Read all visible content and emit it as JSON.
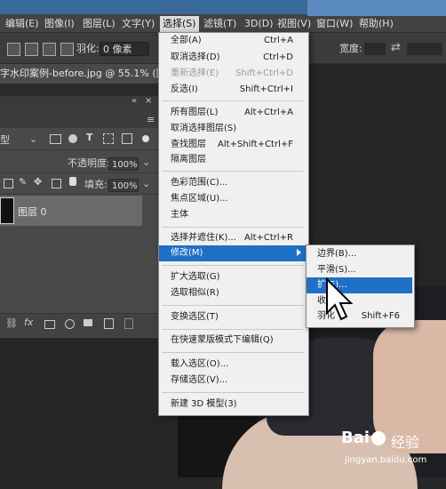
{
  "menubar": {
    "items": [
      "编辑(E)",
      "图像(I)",
      "图层(L)",
      "文字(Y)",
      "选择(S)",
      "滤镜(T)",
      "3D(D)",
      "视图(V)",
      "窗口(W)",
      "帮助(H)"
    ]
  },
  "options_bar": {
    "feather_label": "羽化:",
    "feather_value": "0 像素",
    "width_label": "宽度:"
  },
  "document": {
    "tab_title": "字水印案例-before.jpg @ 55.1% (图层 0"
  },
  "layers_panel": {
    "kind_filter": "型",
    "opacity_label": "不透明度:",
    "opacity_value": "100%",
    "lock_label": "锁定:",
    "fill_label": "填充:",
    "fill_value": "100%",
    "layer_name": "图层 0",
    "footer_icons": [
      "link-icon",
      "fx-icon",
      "mask-icon",
      "adjustment-icon",
      "folder-icon",
      "new-layer-icon",
      "trash-icon"
    ]
  },
  "select_menu": {
    "items": [
      {
        "label": "全部(A)",
        "shortcut": "Ctrl+A",
        "disabled": false
      },
      {
        "label": "取消选择(D)",
        "shortcut": "Ctrl+D",
        "disabled": false
      },
      {
        "label": "重新选择(E)",
        "shortcut": "Shift+Ctrl+D",
        "disabled": true
      },
      {
        "label": "反选(I)",
        "shortcut": "Shift+Ctrl+I",
        "disabled": false
      },
      {
        "label": "所有图层(L)",
        "shortcut": "Alt+Ctrl+A",
        "disabled": false
      },
      {
        "label": "取消选择图层(S)",
        "shortcut": "",
        "disabled": false
      },
      {
        "label": "查找图层",
        "shortcut": "Alt+Shift+Ctrl+F",
        "disabled": false
      },
      {
        "label": "隔离图层",
        "shortcut": "",
        "disabled": false
      },
      {
        "label": "色彩范围(C)...",
        "shortcut": "",
        "disabled": false
      },
      {
        "label": "焦点区域(U)...",
        "shortcut": "",
        "disabled": false
      },
      {
        "label": "主体",
        "shortcut": "",
        "disabled": false
      },
      {
        "label": "选择并遮住(K)...",
        "shortcut": "Alt+Ctrl+R",
        "disabled": false
      },
      {
        "label": "修改(M)",
        "shortcut": "",
        "disabled": false
      },
      {
        "label": "扩大选取(G)",
        "shortcut": "",
        "disabled": false
      },
      {
        "label": "选取相似(R)",
        "shortcut": "",
        "disabled": false
      },
      {
        "label": "变换选区(T)",
        "shortcut": "",
        "disabled": false
      },
      {
        "label": "在快速蒙版模式下编辑(Q)",
        "shortcut": "",
        "disabled": false
      },
      {
        "label": "载入选区(O)...",
        "shortcut": "",
        "disabled": false
      },
      {
        "label": "存储选区(V)...",
        "shortcut": "",
        "disabled": false
      },
      {
        "label": "新建 3D 模型(3)",
        "shortcut": "",
        "disabled": false
      }
    ]
  },
  "modify_submenu": {
    "items": [
      {
        "label": "边界(B)...",
        "shortcut": ""
      },
      {
        "label": "平滑(S)...",
        "shortcut": ""
      },
      {
        "label": "扩(E)...",
        "shortcut": ""
      },
      {
        "label": "收",
        "shortcut": ""
      },
      {
        "label": "羽化",
        "shortcut": "Shift+F6"
      }
    ]
  },
  "watermark": {
    "brand": "Bai",
    "brand2": "经验",
    "url": "jingyan.baidu.com"
  },
  "colors": {
    "highlight": "#1f6fc6",
    "menu_bg": "#f0f0f0",
    "panel_bg": "#494949"
  }
}
